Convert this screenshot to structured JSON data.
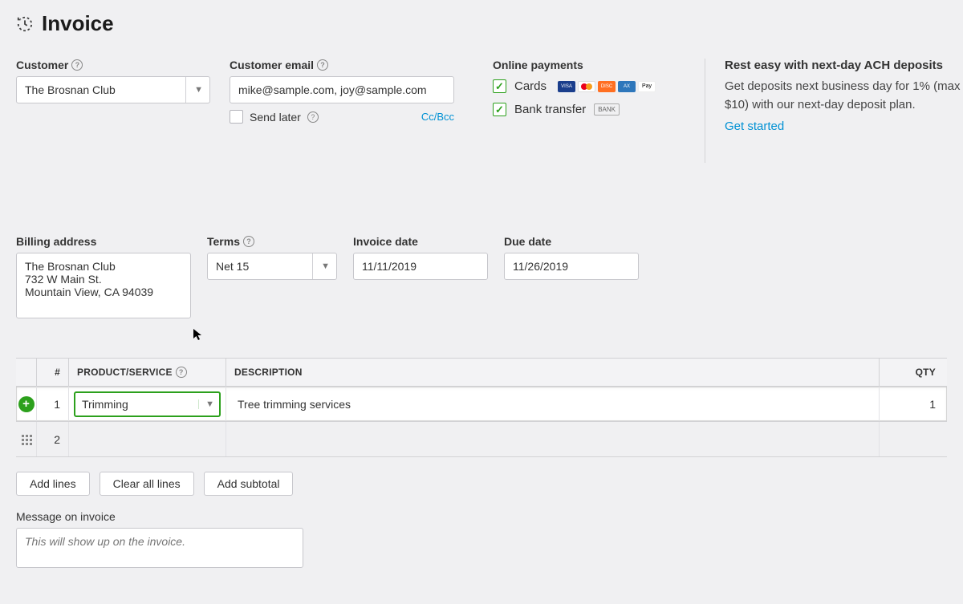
{
  "header": {
    "title": "Invoice"
  },
  "fields": {
    "customer_label": "Customer",
    "customer_value": "The Brosnan Club",
    "email_label": "Customer email",
    "email_value": "mike@sample.com, joy@sample.com",
    "send_later_label": "Send later",
    "ccbcc_label": "Cc/Bcc",
    "billing_label": "Billing address",
    "billing_value": "The Brosnan Club\n732 W Main St.\nMountain View, CA 94039",
    "terms_label": "Terms",
    "terms_value": "Net 15",
    "invoice_date_label": "Invoice date",
    "invoice_date_value": "11/11/2019",
    "due_date_label": "Due date",
    "due_date_value": "11/26/2019"
  },
  "payments": {
    "title": "Online payments",
    "cards_label": "Cards",
    "bank_label": "Bank transfer",
    "bank_badge": "BANK"
  },
  "promo": {
    "head": "Rest easy with next-day ACH deposits",
    "body": "Get deposits next business day for 1% (max $10) with our next-day deposit plan.",
    "link": "Get started"
  },
  "lines": {
    "col_num": "#",
    "col_product": "PRODUCT/SERVICE",
    "col_desc": "DESCRIPTION",
    "col_qty": "QTY",
    "rows": [
      {
        "num": "1",
        "product": "Trimming",
        "desc": "Tree trimming services",
        "qty": "1"
      },
      {
        "num": "2",
        "product": "",
        "desc": "",
        "qty": ""
      }
    ],
    "add_lines": "Add lines",
    "clear_all": "Clear all lines",
    "add_subtotal": "Add subtotal"
  },
  "message": {
    "label": "Message on invoice",
    "placeholder": "This will show up on the invoice."
  }
}
